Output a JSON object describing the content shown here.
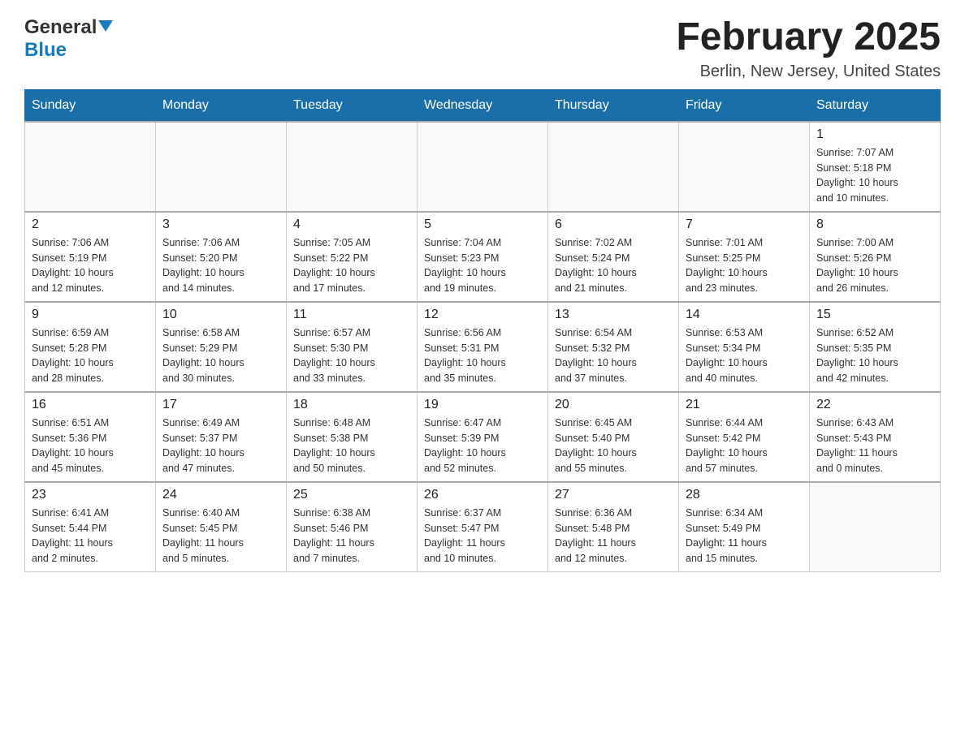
{
  "header": {
    "logo_general": "General",
    "logo_blue": "Blue",
    "title": "February 2025",
    "location": "Berlin, New Jersey, United States"
  },
  "days_of_week": [
    "Sunday",
    "Monday",
    "Tuesday",
    "Wednesday",
    "Thursday",
    "Friday",
    "Saturday"
  ],
  "weeks": [
    [
      {
        "day": "",
        "info": ""
      },
      {
        "day": "",
        "info": ""
      },
      {
        "day": "",
        "info": ""
      },
      {
        "day": "",
        "info": ""
      },
      {
        "day": "",
        "info": ""
      },
      {
        "day": "",
        "info": ""
      },
      {
        "day": "1",
        "info": "Sunrise: 7:07 AM\nSunset: 5:18 PM\nDaylight: 10 hours\nand 10 minutes."
      }
    ],
    [
      {
        "day": "2",
        "info": "Sunrise: 7:06 AM\nSunset: 5:19 PM\nDaylight: 10 hours\nand 12 minutes."
      },
      {
        "day": "3",
        "info": "Sunrise: 7:06 AM\nSunset: 5:20 PM\nDaylight: 10 hours\nand 14 minutes."
      },
      {
        "day": "4",
        "info": "Sunrise: 7:05 AM\nSunset: 5:22 PM\nDaylight: 10 hours\nand 17 minutes."
      },
      {
        "day": "5",
        "info": "Sunrise: 7:04 AM\nSunset: 5:23 PM\nDaylight: 10 hours\nand 19 minutes."
      },
      {
        "day": "6",
        "info": "Sunrise: 7:02 AM\nSunset: 5:24 PM\nDaylight: 10 hours\nand 21 minutes."
      },
      {
        "day": "7",
        "info": "Sunrise: 7:01 AM\nSunset: 5:25 PM\nDaylight: 10 hours\nand 23 minutes."
      },
      {
        "day": "8",
        "info": "Sunrise: 7:00 AM\nSunset: 5:26 PM\nDaylight: 10 hours\nand 26 minutes."
      }
    ],
    [
      {
        "day": "9",
        "info": "Sunrise: 6:59 AM\nSunset: 5:28 PM\nDaylight: 10 hours\nand 28 minutes."
      },
      {
        "day": "10",
        "info": "Sunrise: 6:58 AM\nSunset: 5:29 PM\nDaylight: 10 hours\nand 30 minutes."
      },
      {
        "day": "11",
        "info": "Sunrise: 6:57 AM\nSunset: 5:30 PM\nDaylight: 10 hours\nand 33 minutes."
      },
      {
        "day": "12",
        "info": "Sunrise: 6:56 AM\nSunset: 5:31 PM\nDaylight: 10 hours\nand 35 minutes."
      },
      {
        "day": "13",
        "info": "Sunrise: 6:54 AM\nSunset: 5:32 PM\nDaylight: 10 hours\nand 37 minutes."
      },
      {
        "day": "14",
        "info": "Sunrise: 6:53 AM\nSunset: 5:34 PM\nDaylight: 10 hours\nand 40 minutes."
      },
      {
        "day": "15",
        "info": "Sunrise: 6:52 AM\nSunset: 5:35 PM\nDaylight: 10 hours\nand 42 minutes."
      }
    ],
    [
      {
        "day": "16",
        "info": "Sunrise: 6:51 AM\nSunset: 5:36 PM\nDaylight: 10 hours\nand 45 minutes."
      },
      {
        "day": "17",
        "info": "Sunrise: 6:49 AM\nSunset: 5:37 PM\nDaylight: 10 hours\nand 47 minutes."
      },
      {
        "day": "18",
        "info": "Sunrise: 6:48 AM\nSunset: 5:38 PM\nDaylight: 10 hours\nand 50 minutes."
      },
      {
        "day": "19",
        "info": "Sunrise: 6:47 AM\nSunset: 5:39 PM\nDaylight: 10 hours\nand 52 minutes."
      },
      {
        "day": "20",
        "info": "Sunrise: 6:45 AM\nSunset: 5:40 PM\nDaylight: 10 hours\nand 55 minutes."
      },
      {
        "day": "21",
        "info": "Sunrise: 6:44 AM\nSunset: 5:42 PM\nDaylight: 10 hours\nand 57 minutes."
      },
      {
        "day": "22",
        "info": "Sunrise: 6:43 AM\nSunset: 5:43 PM\nDaylight: 11 hours\nand 0 minutes."
      }
    ],
    [
      {
        "day": "23",
        "info": "Sunrise: 6:41 AM\nSunset: 5:44 PM\nDaylight: 11 hours\nand 2 minutes."
      },
      {
        "day": "24",
        "info": "Sunrise: 6:40 AM\nSunset: 5:45 PM\nDaylight: 11 hours\nand 5 minutes."
      },
      {
        "day": "25",
        "info": "Sunrise: 6:38 AM\nSunset: 5:46 PM\nDaylight: 11 hours\nand 7 minutes."
      },
      {
        "day": "26",
        "info": "Sunrise: 6:37 AM\nSunset: 5:47 PM\nDaylight: 11 hours\nand 10 minutes."
      },
      {
        "day": "27",
        "info": "Sunrise: 6:36 AM\nSunset: 5:48 PM\nDaylight: 11 hours\nand 12 minutes."
      },
      {
        "day": "28",
        "info": "Sunrise: 6:34 AM\nSunset: 5:49 PM\nDaylight: 11 hours\nand 15 minutes."
      },
      {
        "day": "",
        "info": ""
      }
    ]
  ]
}
